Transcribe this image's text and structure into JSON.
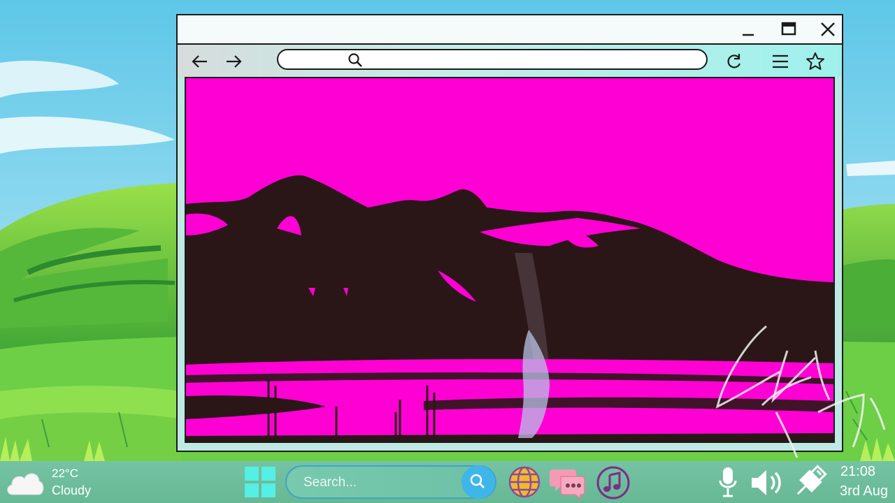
{
  "browser": {
    "address_value": "",
    "colors": {
      "frame": "#1a1a1a",
      "titlebar": "#f4fbfa",
      "toolbar_end": "#9ff0ec"
    }
  },
  "content": {
    "description_colors": {
      "sky": "#ff00d4",
      "land": "#2a1616"
    },
    "watermark": "Ezra Faith"
  },
  "taskbar": {
    "weather": {
      "temp": "22°C",
      "condition": "Cloudy",
      "icon": "cloud-icon"
    },
    "search_placeholder": "Search...",
    "apps": [
      {
        "name": "start",
        "icon": "windows-logo-icon"
      },
      {
        "name": "browser",
        "icon": "globe-icon"
      },
      {
        "name": "messages",
        "icon": "chat-bubbles-icon"
      },
      {
        "name": "music",
        "icon": "music-note-icon"
      }
    ],
    "tray": [
      "microphone-icon",
      "speaker-icon",
      "usb-plug-icon"
    ],
    "clock": {
      "time": "21:08",
      "date": "3rd Aug"
    }
  }
}
